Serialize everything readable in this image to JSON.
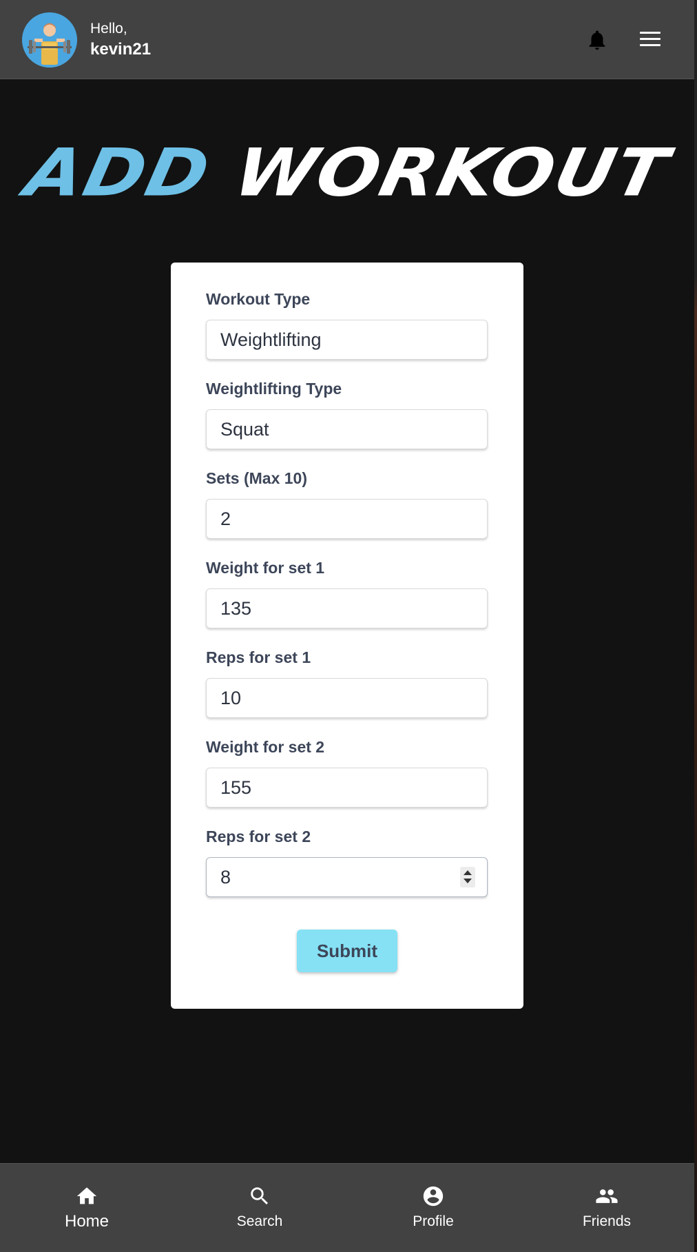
{
  "header": {
    "greeting": "Hello,",
    "username": "kevin21"
  },
  "title": {
    "word1": "ADD",
    "word2": "WORKOUT"
  },
  "form": {
    "fields": [
      {
        "label": "Workout Type",
        "value": "Weightlifting"
      },
      {
        "label": "Weightlifting Type",
        "value": "Squat"
      },
      {
        "label": "Sets (Max 10)",
        "value": "2"
      },
      {
        "label": "Weight for set 1",
        "value": "135"
      },
      {
        "label": "Reps for set 1",
        "value": "10"
      },
      {
        "label": "Weight for set 2",
        "value": "155"
      },
      {
        "label": "Reps for set 2",
        "value": "8"
      }
    ],
    "submit_label": "Submit"
  },
  "bottom_nav": {
    "items": [
      {
        "label": "Home",
        "icon": "home-icon"
      },
      {
        "label": "Search",
        "icon": "search-icon"
      },
      {
        "label": "Profile",
        "icon": "account-circle-icon"
      },
      {
        "label": "Friends",
        "icon": "people-icon"
      }
    ]
  },
  "colors": {
    "background": "#121212",
    "bar": "#424242",
    "accent": "#6ec0e6",
    "submit": "#86e1f4",
    "label_text": "#3d4659"
  }
}
